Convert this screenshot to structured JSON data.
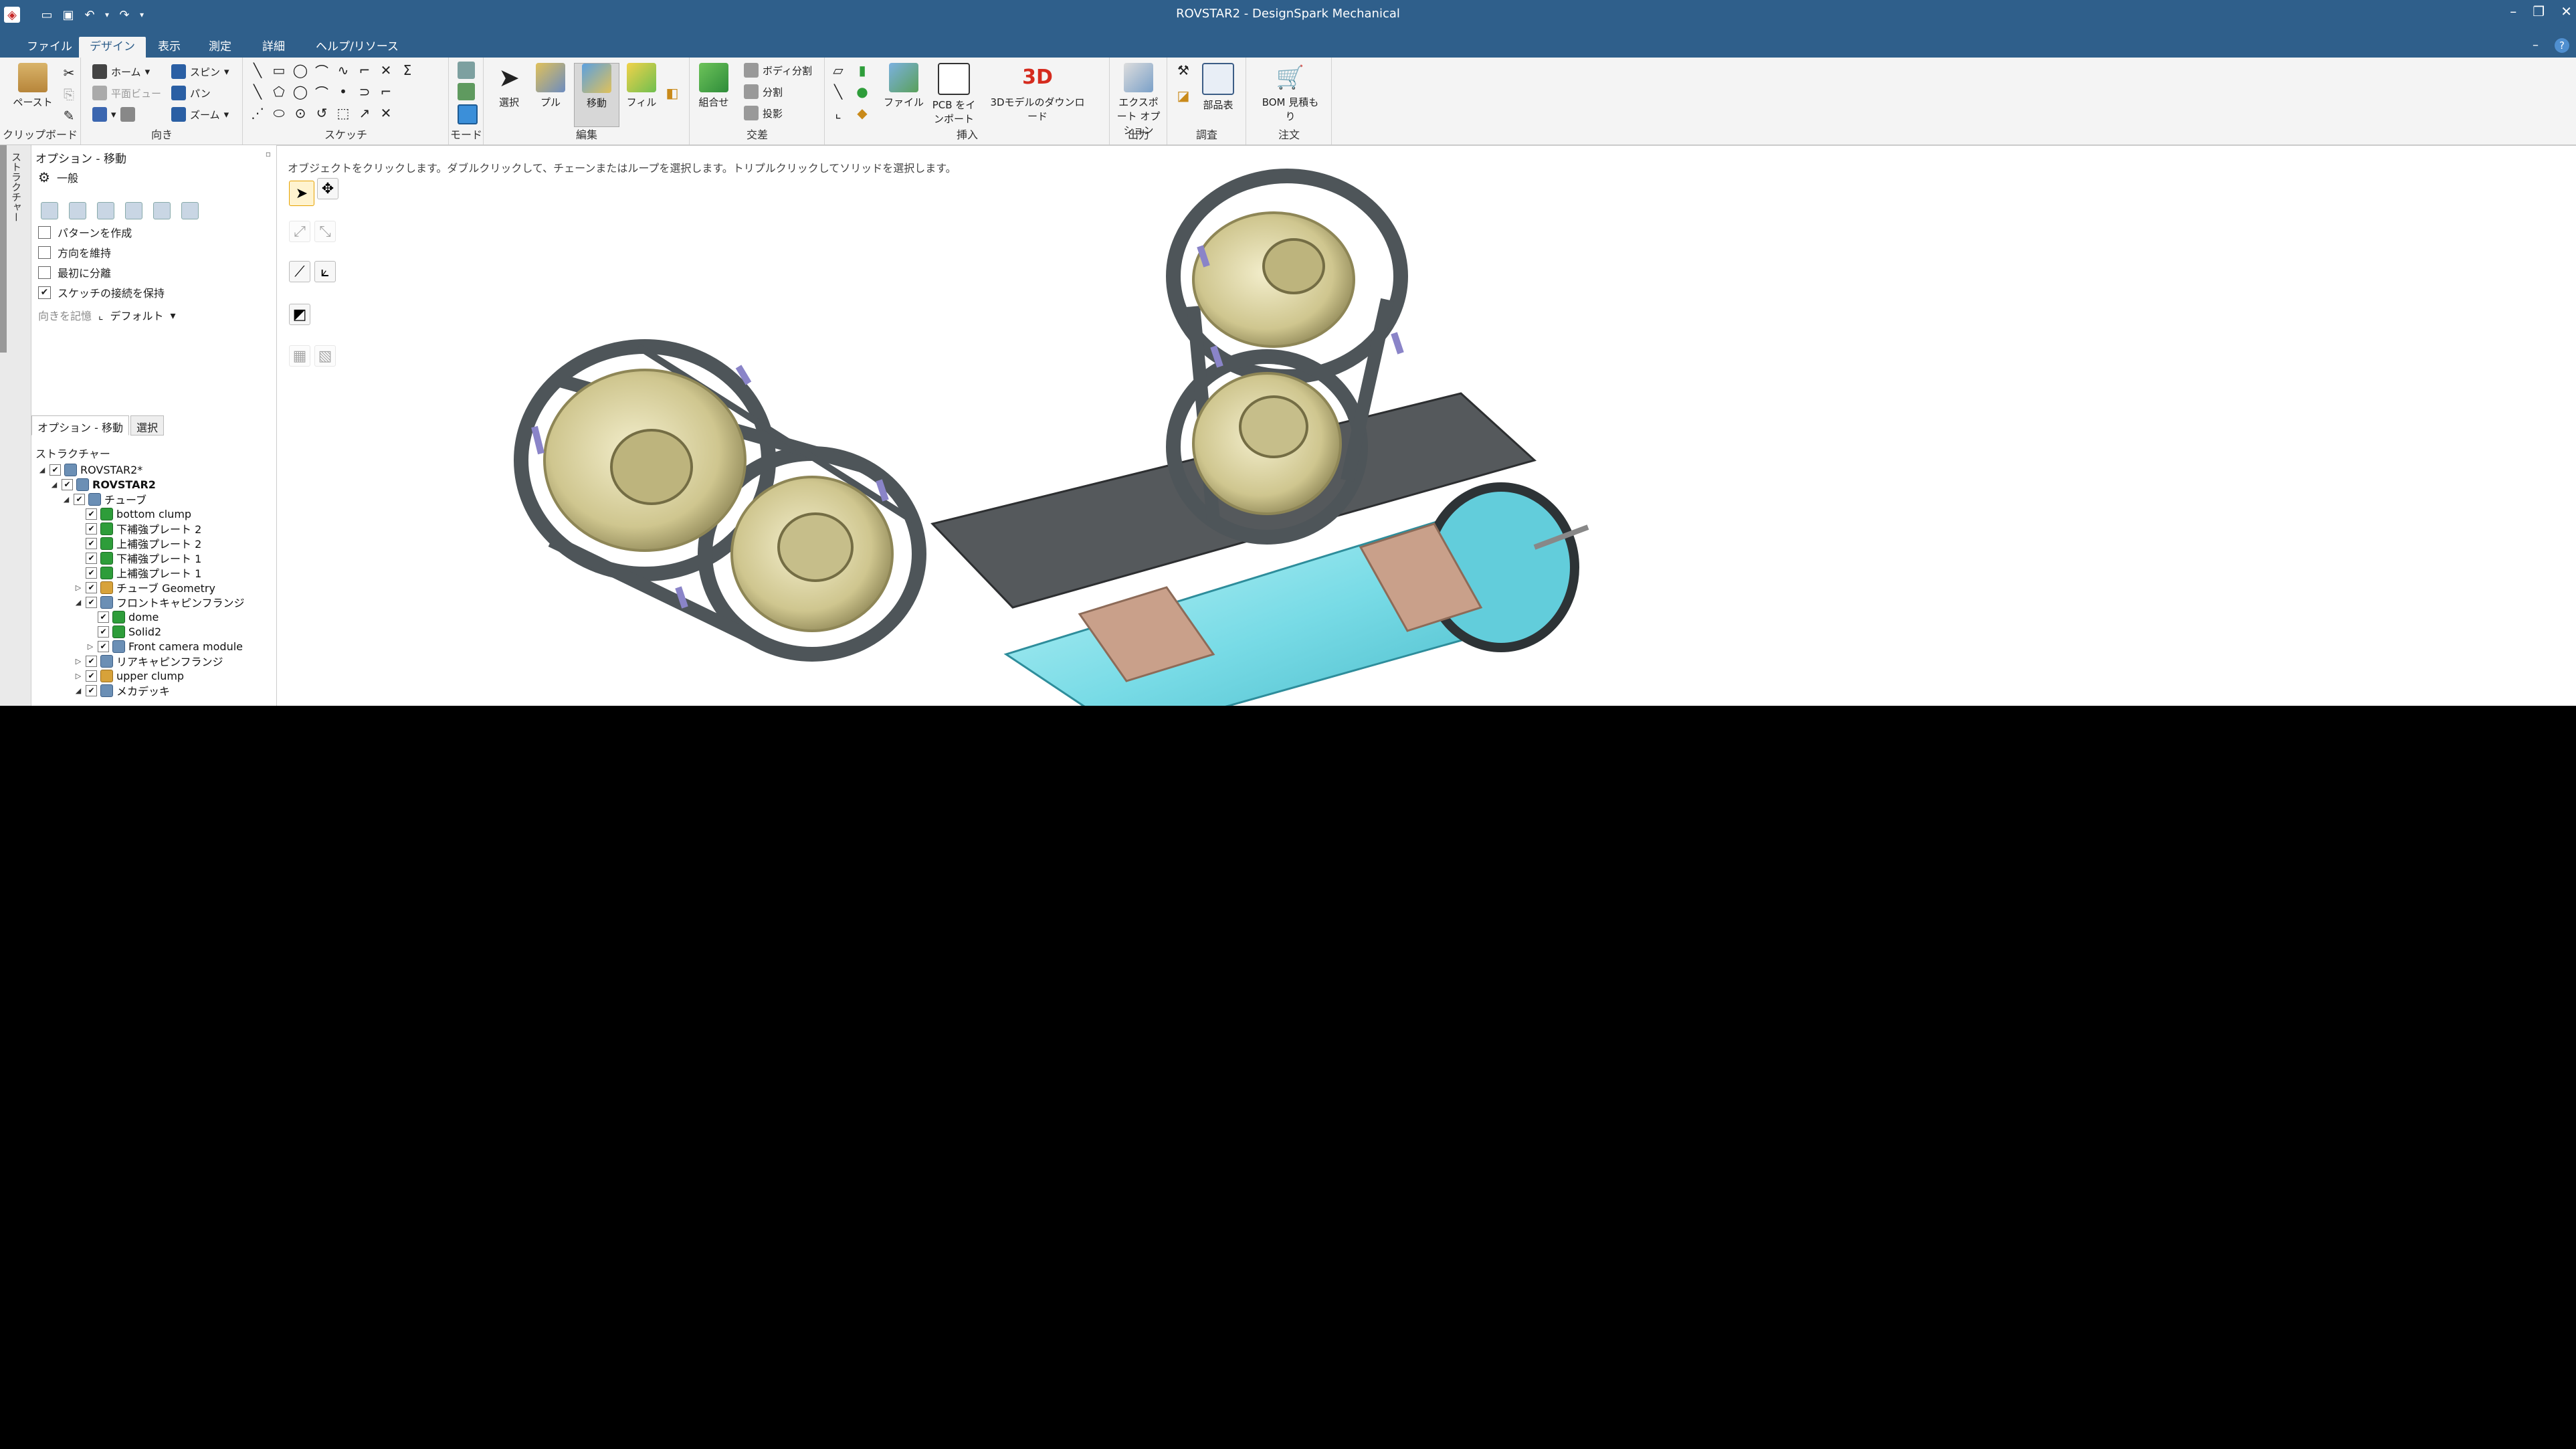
{
  "window": {
    "title": "ROVSTAR2 - DesignSpark Mechanical"
  },
  "ribbon_tabs": [
    "ファイル",
    "デザイン",
    "表示",
    "測定",
    "詳細",
    "ヘルプ/リソース"
  ],
  "ribbon": {
    "clipboard": {
      "paste": "ペースト",
      "label": "クリップボード"
    },
    "orient": {
      "home": "ホーム",
      "plan_view": "平面ビュー",
      "spin": "スピン",
      "pan": "パン",
      "zoom": "ズーム",
      "label": "向き"
    },
    "sketch": {
      "label": "スケッチ"
    },
    "mode": {
      "label": "モード"
    },
    "edit": {
      "select": "選択",
      "pull": "プル",
      "move": "移動",
      "fill": "フィル",
      "label": "編集"
    },
    "intersect": {
      "combine": "組合せ",
      "split_body": "ボディ分割",
      "split": "分割",
      "project": "投影",
      "label": "交差"
    },
    "insert": {
      "file": "ファイル",
      "pcb": "PCB をインポート",
      "model_dl_icon": "3D",
      "model_dl": "3Dモデルのダウンロード",
      "label": "挿入"
    },
    "output": {
      "export": "エクスポート オプション",
      "label": "出力"
    },
    "survey": {
      "parts_list": "部品表",
      "label": "調査"
    },
    "order": {
      "bom": "BOM 見積もり",
      "label": "注文"
    }
  },
  "side_strip": {
    "label": "ストラクチャー"
  },
  "options_panel": {
    "header": "オプション - 移動",
    "general": "一般",
    "options": [
      {
        "label": "パターンを作成",
        "checked": false
      },
      {
        "label": "方向を維持",
        "checked": false
      },
      {
        "label": "最初に分離",
        "checked": false
      },
      {
        "label": "スケッチの接続を保持",
        "checked": true
      }
    ],
    "orientation_label": "向きを記憶",
    "orientation_value": "デフォルト",
    "subtabs": [
      "オプション - 移動",
      "選択"
    ]
  },
  "structure": {
    "header": "ストラクチャー",
    "nodes": [
      {
        "label": "ROVSTAR2*",
        "level": 0,
        "icon": "assy",
        "twisty": "open"
      },
      {
        "label": "ROVSTAR2",
        "level": 1,
        "icon": "assy",
        "twisty": "open",
        "bold": true
      },
      {
        "label": "チューブ",
        "level": 2,
        "icon": "assy",
        "twisty": "open"
      },
      {
        "label": "bottom clump",
        "level": 3,
        "icon": "body",
        "twisty": ""
      },
      {
        "label": "下補強プレート 2",
        "level": 3,
        "icon": "body",
        "twisty": ""
      },
      {
        "label": "上補強プレート 2",
        "level": 3,
        "icon": "body",
        "twisty": ""
      },
      {
        "label": "下補強プレート 1",
        "level": 3,
        "icon": "body",
        "twisty": ""
      },
      {
        "label": "上補強プレート 1",
        "level": 3,
        "icon": "body",
        "twisty": ""
      },
      {
        "label": "チューブ Geometry",
        "level": 3,
        "icon": "geo",
        "twisty": "closed"
      },
      {
        "label": "フロントキャピンフランジ",
        "level": 3,
        "icon": "assy",
        "twisty": "open"
      },
      {
        "label": "dome",
        "level": 4,
        "icon": "body",
        "twisty": ""
      },
      {
        "label": "Solid2",
        "level": 4,
        "icon": "body",
        "twisty": ""
      },
      {
        "label": "Front camera module",
        "level": 4,
        "icon": "assy",
        "twisty": "closed"
      },
      {
        "label": "リアキャピンフランジ",
        "level": 3,
        "icon": "assy",
        "twisty": "closed"
      },
      {
        "label": "upper clump",
        "level": 3,
        "icon": "geo",
        "twisty": "closed"
      },
      {
        "label": "メカデッキ",
        "level": 3,
        "icon": "assy",
        "twisty": "open"
      }
    ]
  },
  "viewport": {
    "hint": "オブジェクトをクリックします。ダブルクリックして、チェーンまたはループを選択します。トリプルクリックしてソリッドを選択します。"
  },
  "colors": {
    "title_bar": "#2f5f8b",
    "ribbon": "#f4f4f4",
    "tube_glass": "#7fe1ea",
    "thruster": "#d9d3a4",
    "frame": "#4e5559",
    "band": "#c9a08a"
  }
}
